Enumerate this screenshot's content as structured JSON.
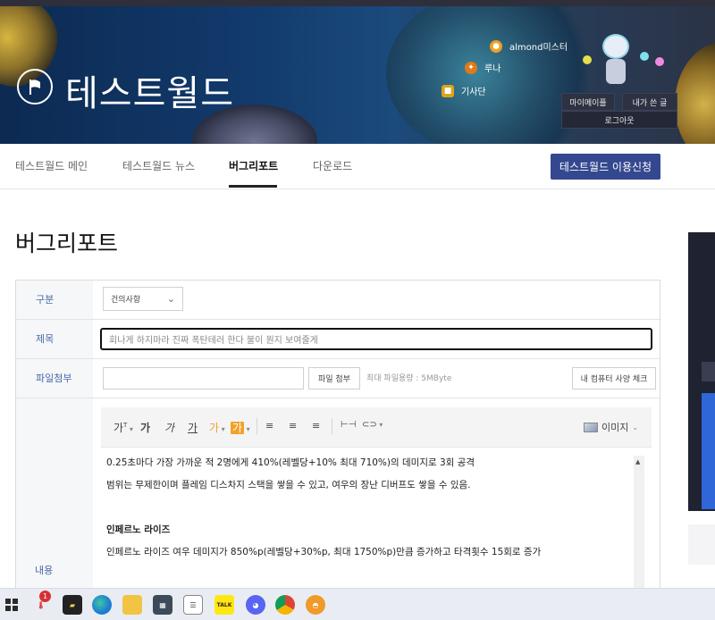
{
  "header": {
    "site_title": "테스트월드",
    "user": {
      "name": "almond미스터",
      "job": "루나",
      "guild": "기사단"
    },
    "account_links": {
      "mypage": "마이메이플",
      "my_posts": "내가 쓴 글",
      "logout": "로그아웃"
    }
  },
  "nav": {
    "items": [
      "테스트월드 메인",
      "테스트월드 뉴스",
      "버그리포트",
      "다운로드"
    ],
    "active_index": 2,
    "apply_button": "테스트월드 이용신청"
  },
  "page": {
    "title": "버그리포트"
  },
  "form": {
    "labels": {
      "category": "구분",
      "subject": "제목",
      "attachment": "파일첨부",
      "content": "내용"
    },
    "category_value": "건의사항",
    "subject_value": "회나게 하지마라 진짜 폭탄테러 한다 불이 뭔지 보여줄게",
    "attach_button": "파일 첨부",
    "max_size_note": "최대 파일용량 : 5MByte",
    "spec_button": "내 컴퓨터 사양 체크"
  },
  "editor": {
    "toolbar": {
      "font_size": "가",
      "bold": "가",
      "italic": "가",
      "underline": "가",
      "strike": "가",
      "color": "가",
      "highlight": "가",
      "image": "이미지"
    },
    "lines": [
      {
        "text": "0.25초마다 가장 가까운 적 2명에게 410%(레벨당+10% 최대 710%)의 데미지로 3회 공격",
        "bold": false
      },
      {
        "text": "범위는 무제한이며 플레임 디스차지 스택을 쌓을 수 있고, 여우의 장난 디버프도 쌓을 수 있음.",
        "bold": false
      },
      {
        "text": "",
        "bold": false
      },
      {
        "text": "인페르노 라이즈",
        "bold": true
      },
      {
        "text": "인페르노 라이즈 여우 데미지가 850%p(레벨당+30%p, 최대 1750%p)만큼 증가하고 타격횟수 15회로 증가",
        "bold": false
      }
    ]
  },
  "taskbar": {
    "notification_count": "1",
    "kakao_label": "TALK"
  },
  "colors": {
    "accent": "#34488f",
    "label_blue": "#4a6aa8",
    "highlight_orange": "#f2a12b"
  }
}
